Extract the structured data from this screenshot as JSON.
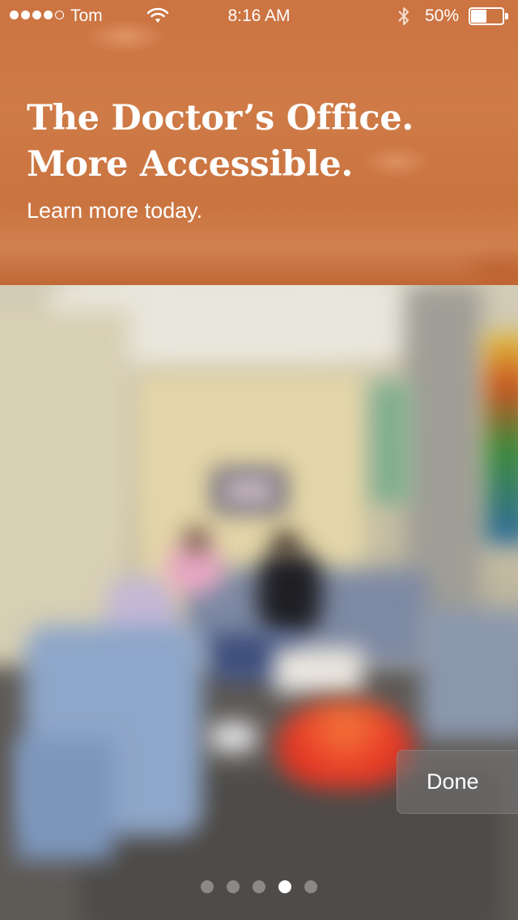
{
  "status_bar": {
    "signal_filled_dots": 4,
    "signal_total_dots": 5,
    "carrier": "Tom",
    "time": "8:16 AM",
    "battery_percent": "50%",
    "battery_level": 0.5,
    "icons": [
      "wifi-icon",
      "bluetooth-icon",
      "battery-icon"
    ]
  },
  "hero": {
    "headline_line1": "The Doctor’s Office.",
    "headline_line2": "More Accessible.",
    "subtitle": "Learn more today.",
    "accent_color": "#cc7442"
  },
  "actions": {
    "done_label": "Done"
  },
  "pagination": {
    "total_pages": 5,
    "current_page": 4
  }
}
